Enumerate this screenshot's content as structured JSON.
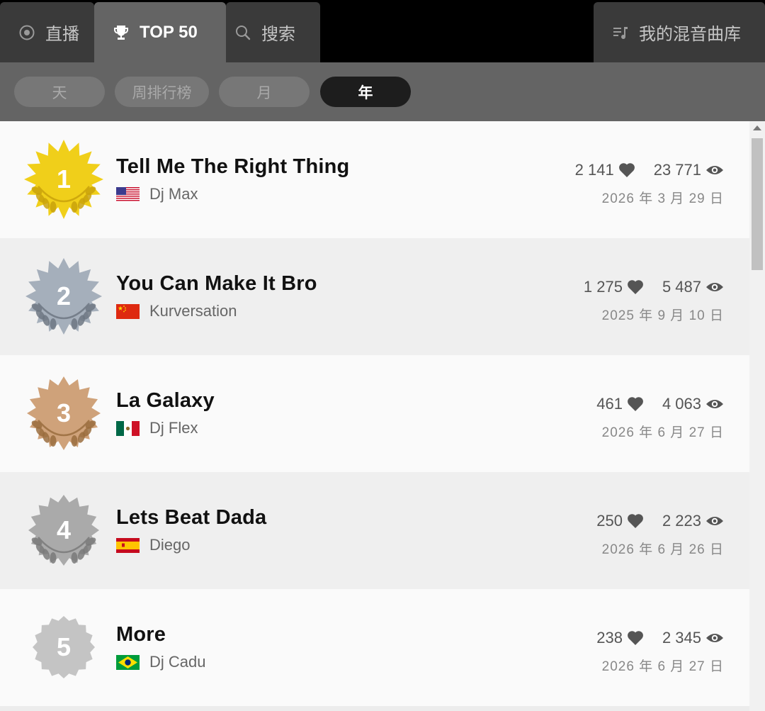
{
  "nav": {
    "live": "直播",
    "top50": "TOP 50",
    "search": "搜索",
    "my_mixes": "我的混音曲库"
  },
  "periods": [
    {
      "label": "天",
      "active": false
    },
    {
      "label": "周排行榜",
      "active": false
    },
    {
      "label": "月",
      "active": false
    },
    {
      "label": "年",
      "active": true
    }
  ],
  "entries": [
    {
      "rank": "1",
      "title": "Tell Me The Right Thing",
      "artist": "Dj Max",
      "flag": "us-flag-icon",
      "likes": "2 141",
      "views": "23 771",
      "date": "2026 年 3 月 29 日",
      "badge_color": "#f0cf1a",
      "badge_type": "gold"
    },
    {
      "rank": "2",
      "title": "You Can Make It Bro",
      "artist": "Kurversation",
      "flag": "china-flag-icon",
      "likes": "1 275",
      "views": "5 487",
      "date": "2025 年 9 月 10 日",
      "badge_color": "#a5afbb",
      "badge_type": "silver"
    },
    {
      "rank": "3",
      "title": "La Galaxy",
      "artist": "Dj Flex",
      "flag": "mexico-flag-icon",
      "likes": "461",
      "views": "4 063",
      "date": "2026 年 6 月 27 日",
      "badge_color": "#cfa27a",
      "badge_type": "bronze"
    },
    {
      "rank": "4",
      "title": "Lets Beat Dada",
      "artist": "Diego",
      "flag": "spain-flag-icon",
      "likes": "250",
      "views": "2 223",
      "date": "2026 年 6 月 26 日",
      "badge_color": "#aaaaaa",
      "badge_type": "gray"
    },
    {
      "rank": "5",
      "title": "More",
      "artist": "Dj Cadu",
      "flag": "brazil-flag-icon",
      "likes": "238",
      "views": "2 345",
      "date": "2026 年 6 月 27 日",
      "badge_color": "#c4c4c4",
      "badge_type": "plain"
    }
  ],
  "colors": {
    "nav_bg": "#000000",
    "tab_inactive": "#3a3a3a",
    "tab_active": "#646464",
    "pill_active": "#1d1d1d"
  }
}
